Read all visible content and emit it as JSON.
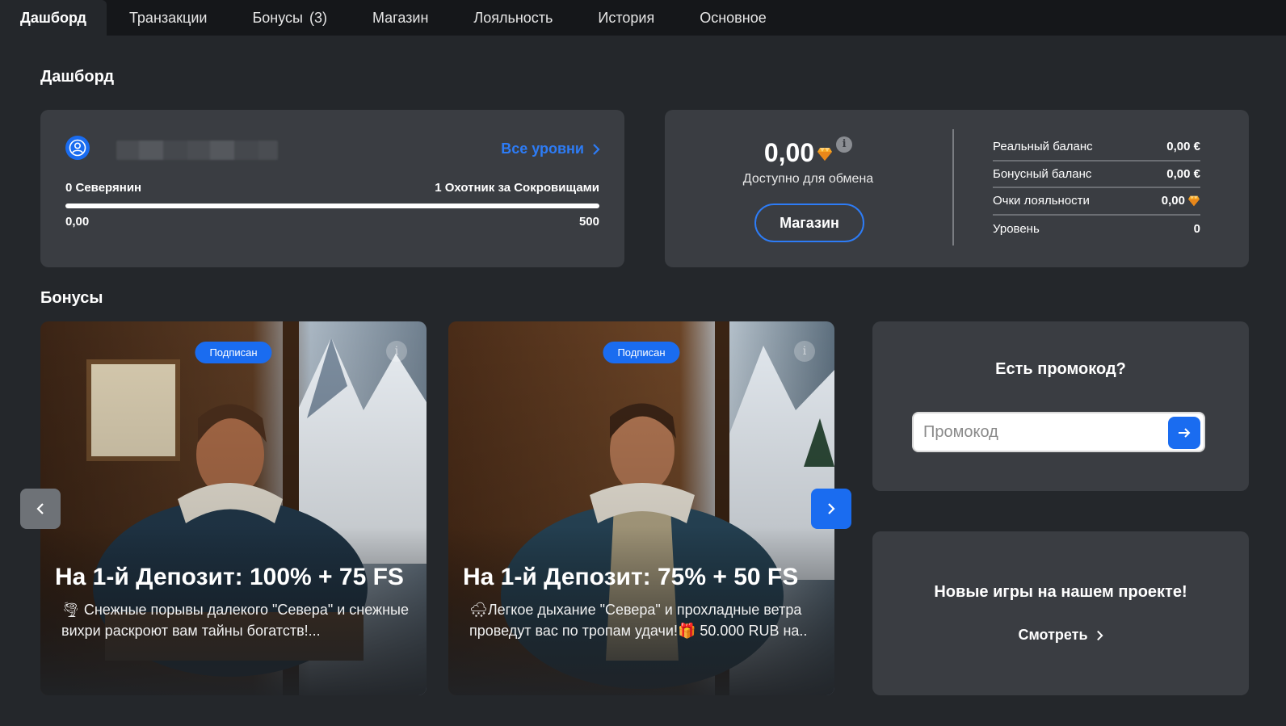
{
  "tabs": [
    {
      "label": "Дашборд",
      "active": true
    },
    {
      "label": "Транзакции"
    },
    {
      "label": "Бонусы",
      "count": "(3)"
    },
    {
      "label": "Магазин"
    },
    {
      "label": "Лояльность"
    },
    {
      "label": "История"
    },
    {
      "label": "Основное"
    }
  ],
  "dashboard": {
    "title": "Дашборд",
    "level_card": {
      "all_levels": "Все уровни",
      "current_level": "0 Северянин",
      "next_level": "1 Охотник за Сокровищами",
      "progress_value": "0,00",
      "progress_target": "500",
      "progress_fraction": 0
    },
    "exchange_card": {
      "available_value": "0,00",
      "available_label": "Доступно для обмена",
      "shop_button": "Магазин",
      "rows": [
        {
          "label": "Реальный баланс",
          "value": "0,00 €"
        },
        {
          "label": "Бонусный баланс",
          "value": "0,00 €"
        },
        {
          "label": "Очки лояльности",
          "value": "0,00",
          "gem": true
        },
        {
          "label": "Уровень",
          "value": "0"
        }
      ]
    }
  },
  "bonuses": {
    "title": "Бонусы",
    "cards": [
      {
        "badge": "Подписан",
        "title": "На 1-й Депозит: 100% + 75 FS",
        "description": "🌪 Снежные порывы далекого \"Севера\" и снежные вихри раскроют вам тайны богатств!..."
      },
      {
        "badge": "Подписан",
        "title": "На 1-й Депозит: 75% + 50 FS",
        "description": "🌨Легкое дыхание \"Севера\" и прохладные ветра проведут вас по тропам удачи!🎁 50.000 RUB на.."
      }
    ]
  },
  "promo": {
    "title": "Есть промокод?",
    "placeholder": "Промокод"
  },
  "new_games": {
    "title": "Новые игры на нашем проекте!",
    "link": "Смотреть"
  },
  "colors": {
    "accent": "#1a6cf0",
    "page_bg": "#24272b",
    "card_bg": "#3a3d42",
    "gem": "#f5a623"
  }
}
